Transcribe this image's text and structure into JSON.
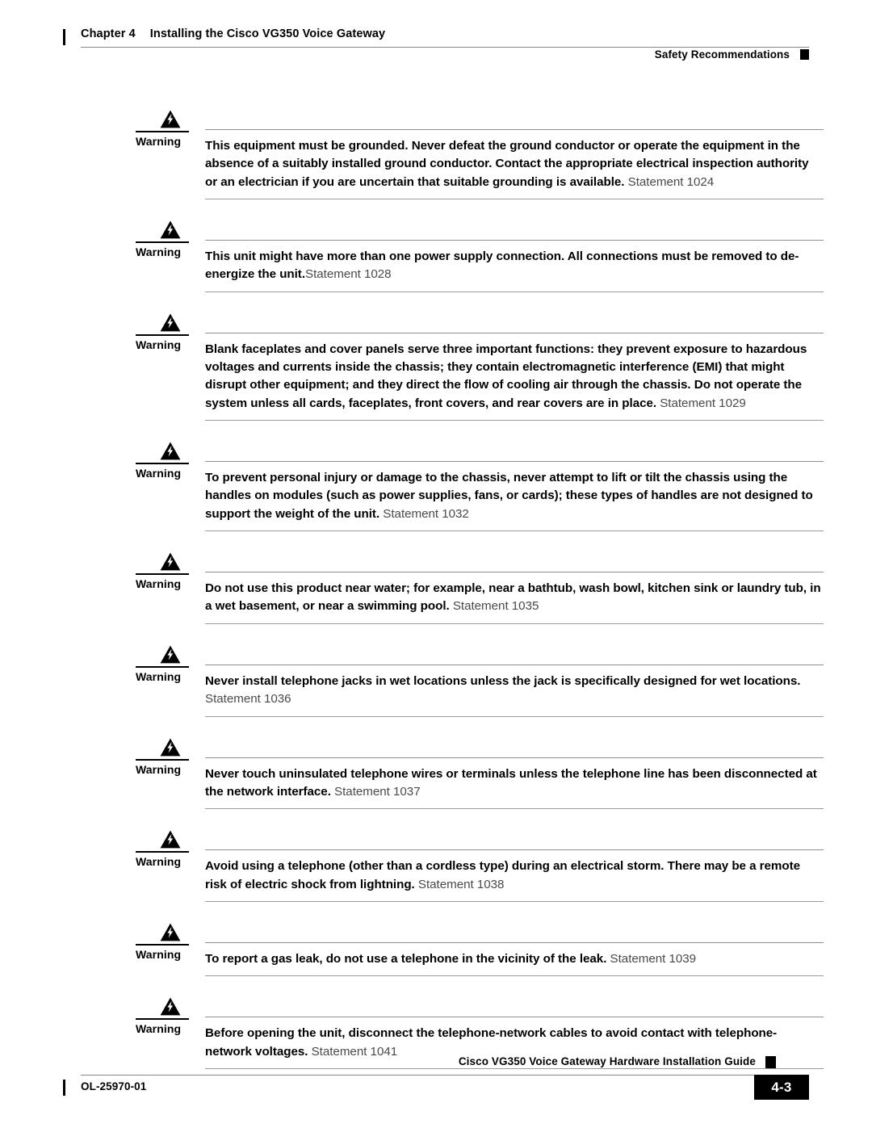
{
  "header": {
    "chapter_label": "Chapter 4",
    "chapter_title": "Installing the Cisco VG350 Voice Gateway",
    "section_title": "Safety Recommendations"
  },
  "warnings": {
    "label": "Warning",
    "icon": "warning-lightning-triangle-icon",
    "items": [
      {
        "text": "This equipment must be grounded. Never defeat the ground conductor or operate the equipment in the absence of a suitably installed ground conductor. Contact the appropriate electrical inspection authority or an electrician if you are uncertain that suitable grounding is available.",
        "statement": " Statement 1024"
      },
      {
        "text": "This unit might have more than one power supply connection. All connections must be removed to de-energize the unit.",
        "statement": "Statement 1028"
      },
      {
        "text": "Blank faceplates and cover panels serve three important functions: they prevent exposure to hazardous voltages and currents inside the chassis; they contain electromagnetic interference (EMI) that might disrupt other equipment; and they direct the flow of cooling air through the chassis. Do not operate the system unless all cards, faceplates, front covers, and rear covers are in place.",
        "statement": " Statement 1029"
      },
      {
        "text": "To prevent personal injury or damage to the chassis, never attempt to lift or tilt the chassis using the handles on modules (such as power supplies, fans, or cards); these types of handles are not designed to support the weight of the unit.",
        "statement": " Statement 1032"
      },
      {
        "text": "Do not use this product near water; for example, near a bathtub, wash bowl, kitchen sink or laundry tub, in a wet basement, or near a swimming pool.",
        "statement": " Statement 1035"
      },
      {
        "text": "Never install telephone jacks in wet locations unless the jack is specifically designed for wet locations.",
        "statement": " Statement 1036"
      },
      {
        "text": "Never touch uninsulated telephone wires or terminals unless the telephone line has been disconnected at the network interface.",
        "statement": " Statement 1037"
      },
      {
        "text": "Avoid using a telephone (other than a cordless type) during an electrical storm. There may be a remote risk of electric shock from lightning.",
        "statement": " Statement 1038"
      },
      {
        "text": "To report a gas leak, do not use a telephone in the vicinity of the leak.",
        "statement": " Statement 1039"
      },
      {
        "text": "Before opening the unit, disconnect the telephone-network cables to avoid contact with telephone-network voltages.",
        "statement": " Statement 1041"
      }
    ]
  },
  "footer": {
    "doc_title": "Cisco VG350 Voice Gateway Hardware Installation Guide",
    "doc_id": "OL-25970-01",
    "page_number": "4-3"
  }
}
